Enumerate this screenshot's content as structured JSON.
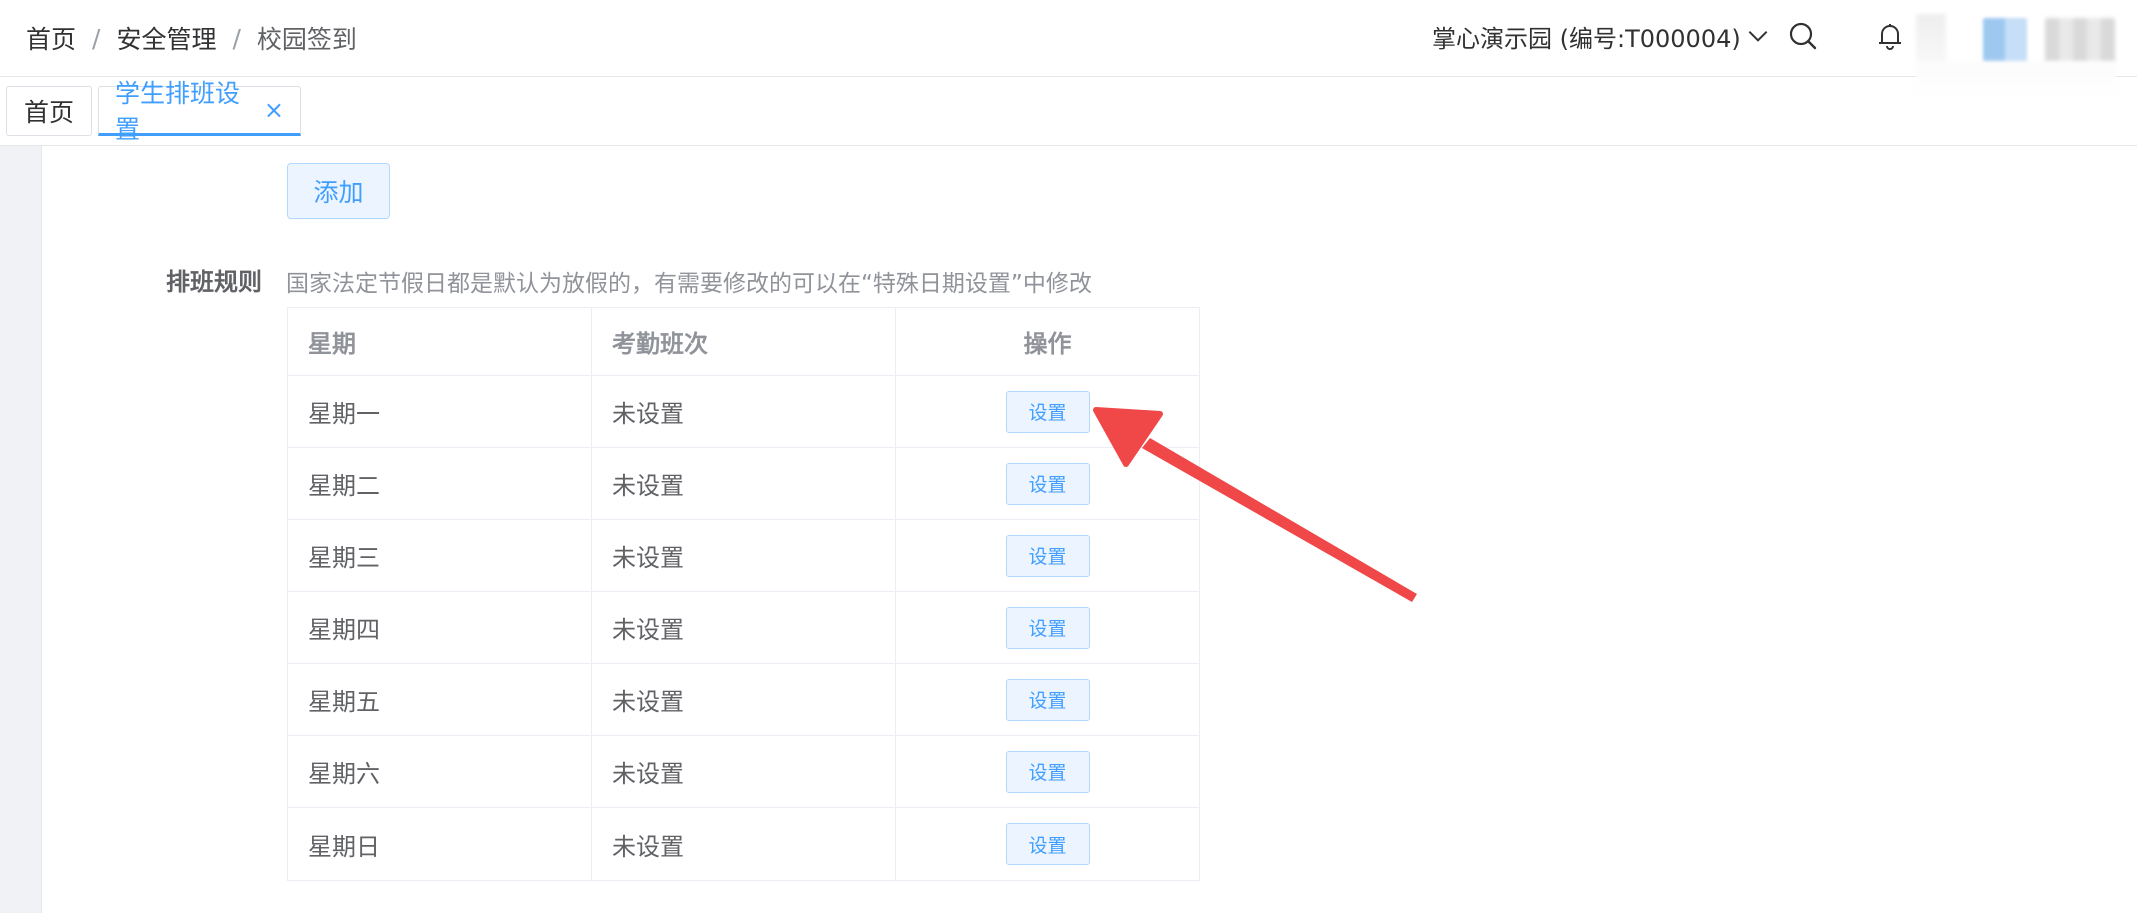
{
  "breadcrumb": {
    "items": [
      "首页",
      "安全管理",
      "校园签到"
    ],
    "separator": "/"
  },
  "header": {
    "org_name": "掌心演示园 (编号:T000004)"
  },
  "tabs": [
    {
      "label": "首页"
    },
    {
      "label": "学生排班设置",
      "close": "×"
    }
  ],
  "content": {
    "add_label": "添加",
    "rule_label": "排班规则",
    "rule_hint": "国家法定节假日都是默认为放假的，有需要修改的可以在“特殊日期设置”中修改"
  },
  "table": {
    "columns": [
      "星期",
      "考勤班次",
      "操作"
    ],
    "rows": [
      {
        "day": "星期一",
        "shift": "未设置",
        "action": "设置"
      },
      {
        "day": "星期二",
        "shift": "未设置",
        "action": "设置"
      },
      {
        "day": "星期三",
        "shift": "未设置",
        "action": "设置"
      },
      {
        "day": "星期四",
        "shift": "未设置",
        "action": "设置"
      },
      {
        "day": "星期五",
        "shift": "未设置",
        "action": "设置"
      },
      {
        "day": "星期六",
        "shift": "未设置",
        "action": "设置"
      },
      {
        "day": "星期日",
        "shift": "未设置",
        "action": "设置"
      }
    ]
  },
  "icons": {
    "search": "search-icon",
    "bell": "bell-icon",
    "dropdown": "chevron-down-icon",
    "annotation": "red-arrow"
  },
  "colors": {
    "accent": "#409eff",
    "annotation": "#f04848"
  }
}
